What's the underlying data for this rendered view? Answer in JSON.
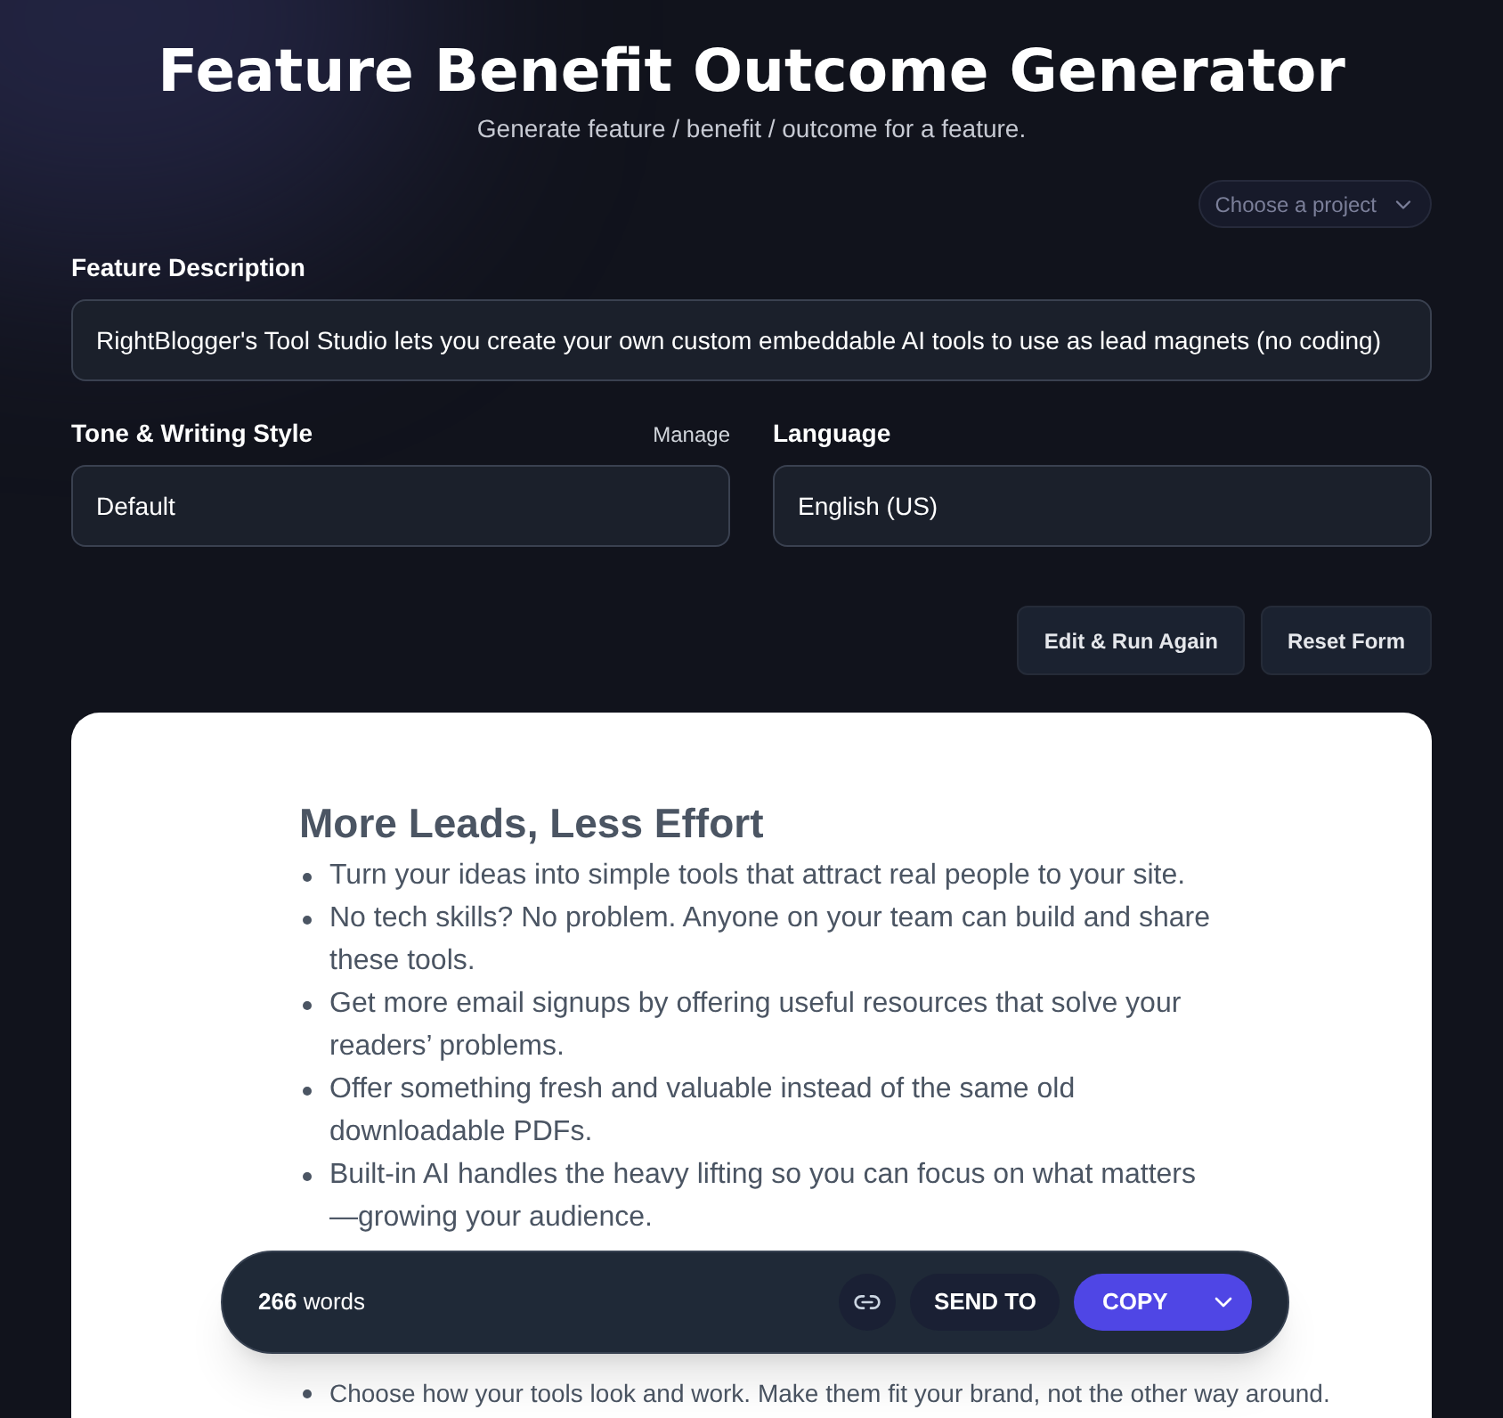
{
  "header": {
    "title": "Feature Benefit Outcome Generator",
    "subtitle": "Generate feature / benefit / outcome for a feature."
  },
  "project_select": {
    "placeholder": "Choose a project"
  },
  "form": {
    "feature": {
      "label": "Feature Description",
      "value": "RightBlogger's Tool Studio lets you create your own custom embeddable AI tools to use as lead magnets (no coding)"
    },
    "tone": {
      "label": "Tone & Writing Style",
      "manage": "Manage",
      "value": "Default"
    },
    "language": {
      "label": "Language",
      "value": "English (US)"
    }
  },
  "actions": [
    "Edit & Run Again",
    "Reset Form"
  ],
  "result": {
    "heading": "More Leads, Less Effort",
    "bullets": [
      "Turn your ideas into simple tools that attract real people to your site.",
      "No tech skills? No problem. Anyone on your team can build and share these tools.",
      "Get more email signups by offering useful resources that solve your readers’ problems.",
      "Offer something fresh and valuable instead of the same old downloadable PDFs.",
      "Built-in AI handles the heavy lifting so you can focus on what matters—growing your audience."
    ],
    "bullets_after": [
      "Choose how your tools look and work. Make them fit your brand, not the other way around."
    ]
  },
  "toolbar": {
    "word_count": "266",
    "words_label": "words",
    "send_to": "SEND TO",
    "copy": "COPY"
  }
}
